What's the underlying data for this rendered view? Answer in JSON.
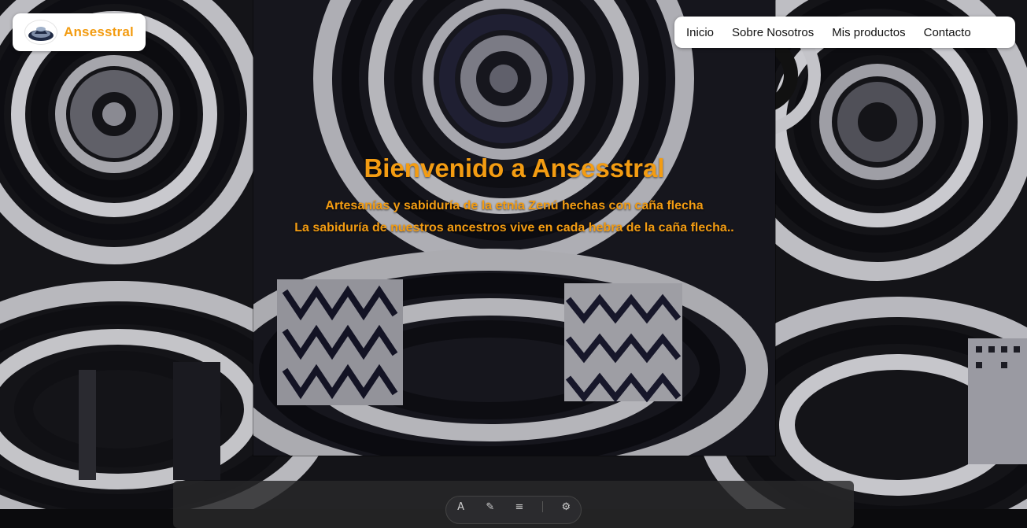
{
  "brand": {
    "name": "Ansesstral",
    "logo_icon": "hat-logo-icon"
  },
  "nav": {
    "items": [
      {
        "label": "Inicio"
      },
      {
        "label": "Sobre Nosotros"
      },
      {
        "label": "Mis productos"
      },
      {
        "label": "Contacto"
      }
    ]
  },
  "hero": {
    "title": "Bienvenido a Ansesstral",
    "subtitle_1": "Artesanías y sabiduría de la etnia Zenú hechas con caña flecha",
    "subtitle_2": "La sabiduría de nuestros ancestros vive en cada hebra de la caña flecha.."
  },
  "colors": {
    "accent": "#f39c12",
    "nav_bg": "#ffffff",
    "text": "#111111"
  },
  "toolbar": {
    "icons": [
      "text-icon",
      "brush-icon",
      "list-icon",
      "settings-icon"
    ]
  }
}
